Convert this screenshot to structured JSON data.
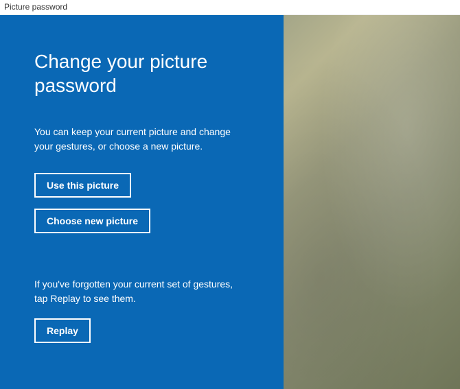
{
  "window": {
    "title": "Picture password"
  },
  "panel": {
    "heading": "Change your picture password",
    "description": "You can keep your current picture and change your gestures, or choose a new picture.",
    "use_picture_label": "Use this picture",
    "choose_new_label": "Choose new picture",
    "replay_hint": "If you've forgotten your current set of gestures, tap Replay to see them.",
    "replay_label": "Replay"
  }
}
